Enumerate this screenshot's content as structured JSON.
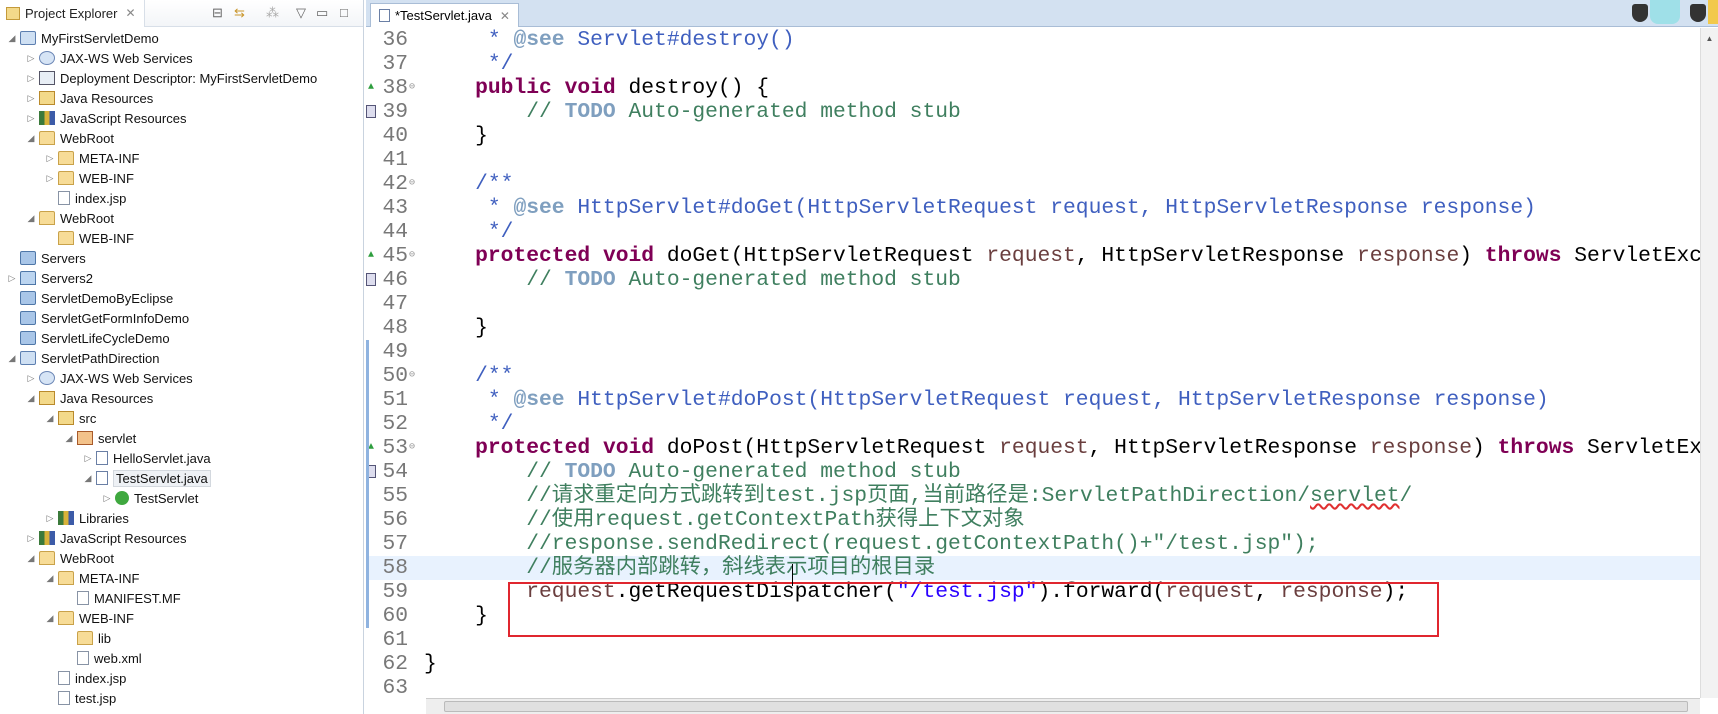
{
  "explorer": {
    "title": "Project Explorer",
    "close": "✕",
    "items": [
      {
        "l": 0,
        "a": "open",
        "i": "project",
        "t": "MyFirstServletDemo"
      },
      {
        "l": 1,
        "a": "closed",
        "i": "webservice",
        "t": "JAX-WS Web Services"
      },
      {
        "l": 1,
        "a": "closed",
        "i": "descriptor",
        "t": "Deployment Descriptor: MyFirstServletDemo"
      },
      {
        "l": 1,
        "a": "closed",
        "i": "java-resources",
        "t": "Java Resources"
      },
      {
        "l": 1,
        "a": "closed",
        "i": "library",
        "t": "JavaScript Resources"
      },
      {
        "l": 1,
        "a": "open",
        "i": "folder",
        "t": "WebRoot"
      },
      {
        "l": 2,
        "a": "closed",
        "i": "folder",
        "t": "META-INF"
      },
      {
        "l": 2,
        "a": "closed",
        "i": "folder",
        "t": "WEB-INF"
      },
      {
        "l": 2,
        "a": "none",
        "i": "file",
        "t": "index.jsp"
      },
      {
        "l": 1,
        "a": "open",
        "i": "folder",
        "t": "WebRoot"
      },
      {
        "l": 2,
        "a": "none",
        "i": "folder",
        "t": "WEB-INF"
      },
      {
        "l": 0,
        "a": "none",
        "i": "closed-project",
        "t": "Servers"
      },
      {
        "l": 0,
        "a": "closed",
        "i": "blue-folder",
        "t": "Servers2"
      },
      {
        "l": 0,
        "a": "none",
        "i": "closed-project",
        "t": "ServletDemoByEclipse"
      },
      {
        "l": 0,
        "a": "none",
        "i": "closed-project",
        "t": "ServletGetFormInfoDemo"
      },
      {
        "l": 0,
        "a": "none",
        "i": "closed-project",
        "t": "ServletLifeCycleDemo"
      },
      {
        "l": 0,
        "a": "open",
        "i": "project",
        "t": "ServletPathDirection"
      },
      {
        "l": 1,
        "a": "closed",
        "i": "webservice",
        "t": "JAX-WS Web Services"
      },
      {
        "l": 1,
        "a": "open",
        "i": "java-resources",
        "t": "Java Resources"
      },
      {
        "l": 2,
        "a": "open",
        "i": "source-folder",
        "t": "src"
      },
      {
        "l": 3,
        "a": "open",
        "i": "package",
        "t": "servlet"
      },
      {
        "l": 4,
        "a": "closed",
        "i": "java-file",
        "t": "HelloServlet.java"
      },
      {
        "l": 4,
        "a": "open",
        "i": "java-file",
        "t": "TestServlet.java",
        "selected": true
      },
      {
        "l": 5,
        "a": "closed",
        "i": "class",
        "t": "TestServlet"
      },
      {
        "l": 2,
        "a": "closed",
        "i": "library",
        "t": "Libraries"
      },
      {
        "l": 1,
        "a": "closed",
        "i": "library",
        "t": "JavaScript Resources"
      },
      {
        "l": 1,
        "a": "open",
        "i": "folder",
        "t": "WebRoot"
      },
      {
        "l": 2,
        "a": "open",
        "i": "folder",
        "t": "META-INF"
      },
      {
        "l": 3,
        "a": "none",
        "i": "file",
        "t": "MANIFEST.MF"
      },
      {
        "l": 2,
        "a": "open",
        "i": "folder",
        "t": "WEB-INF"
      },
      {
        "l": 3,
        "a": "none",
        "i": "folder",
        "t": "lib"
      },
      {
        "l": 3,
        "a": "none",
        "i": "xml-file",
        "t": "web.xml"
      },
      {
        "l": 2,
        "a": "none",
        "i": "file",
        "t": "index.jsp"
      },
      {
        "l": 2,
        "a": "none",
        "i": "file",
        "t": "test.jsp"
      }
    ]
  },
  "editor": {
    "tab": "*TestServlet.java",
    "close": "✕",
    "current_line": 58,
    "colors": {
      "keyword": "#7f0055",
      "comment": "#3f7f5f",
      "javadoc": "#3f5fbf",
      "string": "#2a00ff",
      "highlight_box": "#e0262f"
    },
    "lines": [
      {
        "n": 36,
        "t": [
          [
            "jd",
            "     * "
          ],
          [
            "jt",
            "@see"
          ],
          [
            "jd",
            " Servlet#destroy()"
          ]
        ]
      },
      {
        "n": 37,
        "t": [
          [
            "jd",
            "     */"
          ]
        ]
      },
      {
        "n": 38,
        "fold": true,
        "override": true,
        "t": [
          [
            "pl",
            "    "
          ],
          [
            "kw",
            "public"
          ],
          [
            "pl",
            " "
          ],
          [
            "kw",
            "void"
          ],
          [
            "pl",
            " destroy() {"
          ]
        ]
      },
      {
        "n": 39,
        "task": true,
        "t": [
          [
            "cm",
            "        // "
          ],
          [
            "todo",
            "TODO"
          ],
          [
            "cm",
            " Auto-generated method stub"
          ]
        ]
      },
      {
        "n": 40,
        "t": [
          [
            "pl",
            "    }"
          ]
        ]
      },
      {
        "n": 41,
        "t": []
      },
      {
        "n": 42,
        "fold": true,
        "t": [
          [
            "jd",
            "    /**"
          ]
        ]
      },
      {
        "n": 43,
        "t": [
          [
            "jd",
            "     * "
          ],
          [
            "jt",
            "@see"
          ],
          [
            "jd",
            " HttpServlet#doGet(HttpServletRequest request, HttpServletResponse response)"
          ]
        ]
      },
      {
        "n": 44,
        "t": [
          [
            "jd",
            "     */"
          ]
        ]
      },
      {
        "n": 45,
        "fold": true,
        "override": true,
        "t": [
          [
            "pl",
            "    "
          ],
          [
            "kw",
            "protected"
          ],
          [
            "pl",
            " "
          ],
          [
            "kw",
            "void"
          ],
          [
            "pl",
            " doGet(HttpServletRequest "
          ],
          [
            "var",
            "request"
          ],
          [
            "pl",
            ", HttpServletResponse "
          ],
          [
            "var",
            "response"
          ],
          [
            "pl",
            ") "
          ],
          [
            "kw",
            "throws"
          ],
          [
            "pl",
            " ServletException, IOException {"
          ]
        ]
      },
      {
        "n": 46,
        "task": true,
        "t": [
          [
            "cm",
            "        // "
          ],
          [
            "todo",
            "TODO"
          ],
          [
            "cm",
            " Auto-generated method stub"
          ]
        ]
      },
      {
        "n": 47,
        "t": []
      },
      {
        "n": 48,
        "t": [
          [
            "pl",
            "    }"
          ]
        ]
      },
      {
        "n": 49,
        "changed": true,
        "t": []
      },
      {
        "n": 50,
        "fold": true,
        "changed": true,
        "t": [
          [
            "jd",
            "    /**"
          ]
        ]
      },
      {
        "n": 51,
        "changed": true,
        "t": [
          [
            "jd",
            "     * "
          ],
          [
            "jt",
            "@see"
          ],
          [
            "jd",
            " HttpServlet#doPost(HttpServletRequest request, HttpServletResponse response)"
          ]
        ]
      },
      {
        "n": 52,
        "changed": true,
        "t": [
          [
            "jd",
            "     */"
          ]
        ]
      },
      {
        "n": 53,
        "fold": true,
        "override": true,
        "changed": true,
        "t": [
          [
            "pl",
            "    "
          ],
          [
            "kw",
            "protected"
          ],
          [
            "pl",
            " "
          ],
          [
            "kw",
            "void"
          ],
          [
            "pl",
            " doPost(HttpServletRequest "
          ],
          [
            "var",
            "request"
          ],
          [
            "pl",
            ", HttpServletResponse "
          ],
          [
            "var",
            "response"
          ],
          [
            "pl",
            ") "
          ],
          [
            "kw",
            "throws"
          ],
          [
            "pl",
            " ServletException, IOException {"
          ]
        ]
      },
      {
        "n": 54,
        "task": true,
        "changed": true,
        "t": [
          [
            "cm",
            "        // "
          ],
          [
            "todo",
            "TODO"
          ],
          [
            "cm",
            " Auto-generated method stub"
          ]
        ]
      },
      {
        "n": 55,
        "changed": true,
        "t": [
          [
            "cm",
            "        //请求重定向方式跳转到test.jsp页面,当前路径是:ServletPathDirection/"
          ],
          [
            "cm sq",
            "servlet"
          ],
          [
            "cm",
            "/"
          ]
        ]
      },
      {
        "n": 56,
        "changed": true,
        "t": [
          [
            "cm",
            "        //使用request.getContextPath获得上下文对象"
          ]
        ]
      },
      {
        "n": 57,
        "changed": true,
        "t": [
          [
            "cm",
            "        //response.sendRedirect(request.getContextPath()+\"/test.jsp\");"
          ]
        ]
      },
      {
        "n": 58,
        "changed": true,
        "t": [
          [
            "cm",
            "        //服务器内部跳转，斜线表示项目的根目录"
          ]
        ]
      },
      {
        "n": 59,
        "changed": true,
        "t": [
          [
            "pl",
            "        "
          ],
          [
            "var",
            "request"
          ],
          [
            "pl",
            ".getRequestDispatcher("
          ],
          [
            "str",
            "\"/test.jsp\""
          ],
          [
            "pl",
            ").forward("
          ],
          [
            "var",
            "request"
          ],
          [
            "pl",
            ", "
          ],
          [
            "var",
            "response"
          ],
          [
            "pl",
            ");"
          ]
        ]
      },
      {
        "n": 60,
        "changed": true,
        "t": [
          [
            "pl",
            "    }"
          ]
        ]
      },
      {
        "n": 61,
        "t": []
      },
      {
        "n": 62,
        "t": [
          [
            "pl",
            "}"
          ]
        ]
      },
      {
        "n": 63,
        "t": []
      }
    ]
  }
}
